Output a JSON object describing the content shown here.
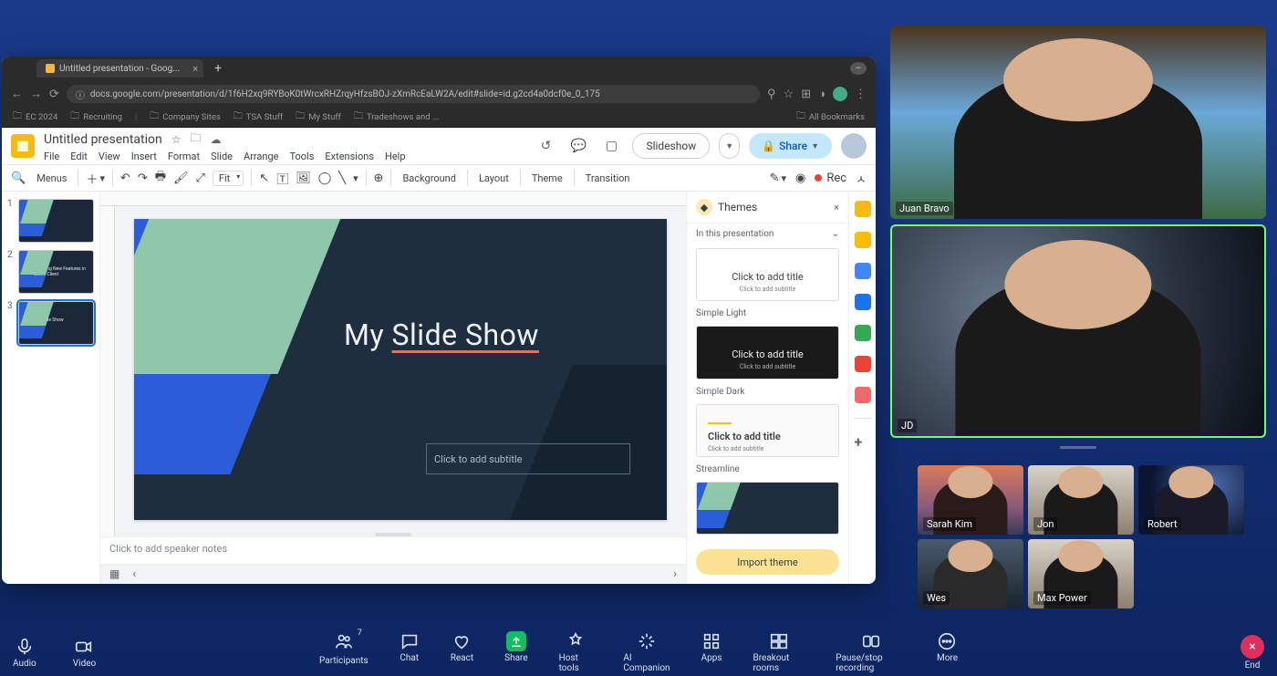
{
  "browser": {
    "tab_title": "Untitled presentation - Goog...",
    "url": "docs.google.com/presentation/d/1f6H2xq9RYBoK0tWrcxRHZrqyHfzsBOJ-zXmRcEaLW2A/edit#slide=id.g2cd4a0dcf0e_0_175",
    "bookmarks": [
      "EC 2024",
      "Recruiting",
      "Company Sites",
      "TSA Stuff",
      "My Stuff",
      "Tradeshows and ..."
    ],
    "all_bookmarks": "All Bookmarks"
  },
  "slides": {
    "doc_title": "Untitled presentation",
    "menus": [
      "File",
      "Edit",
      "View",
      "Insert",
      "Format",
      "Slide",
      "Arrange",
      "Tools",
      "Extensions",
      "Help"
    ],
    "slideshow_btn": "Slideshow",
    "share_btn": "Share",
    "toolbar": {
      "menus": "Menus",
      "fit": "Fit",
      "background": "Background",
      "layout": "Layout",
      "theme": "Theme",
      "transition": "Transition",
      "rec": "Rec"
    },
    "thumbs": [
      {
        "num": "1",
        "title": ""
      },
      {
        "num": "2",
        "title": "Amazing New Features in Zoom Client"
      },
      {
        "num": "3",
        "title": "My Slide Show"
      }
    ],
    "canvas": {
      "title_pre": "My ",
      "title_u": "Slide Show",
      "subtitle_placeholder": "Click to add subtitle"
    },
    "notes_placeholder": "Click to add speaker notes",
    "themes": {
      "header": "Themes",
      "in_presentation": "In this presentation",
      "card_title": "Click to add title",
      "card_sub": "Click to add subtitle",
      "names": [
        "Simple Light",
        "Simple Dark",
        "Streamline"
      ],
      "import": "Import theme"
    }
  },
  "zoom": {
    "participants": [
      {
        "name": "Juan Bravo"
      },
      {
        "name": "JD"
      }
    ],
    "thumbs": [
      {
        "name": "Sarah Kim"
      },
      {
        "name": "Jon"
      },
      {
        "name": "Robert"
      },
      {
        "name": "Wes"
      },
      {
        "name": "Max Power"
      }
    ],
    "toolbar": {
      "audio": "Audio",
      "video": "Video",
      "participants": "Participants",
      "part_count": "7",
      "chat": "Chat",
      "react": "React",
      "share": "Share",
      "host": "Host tools",
      "ai": "AI Companion",
      "apps": "Apps",
      "breakout": "Breakout rooms",
      "record": "Pause/stop recording",
      "more": "More",
      "end": "End"
    }
  }
}
